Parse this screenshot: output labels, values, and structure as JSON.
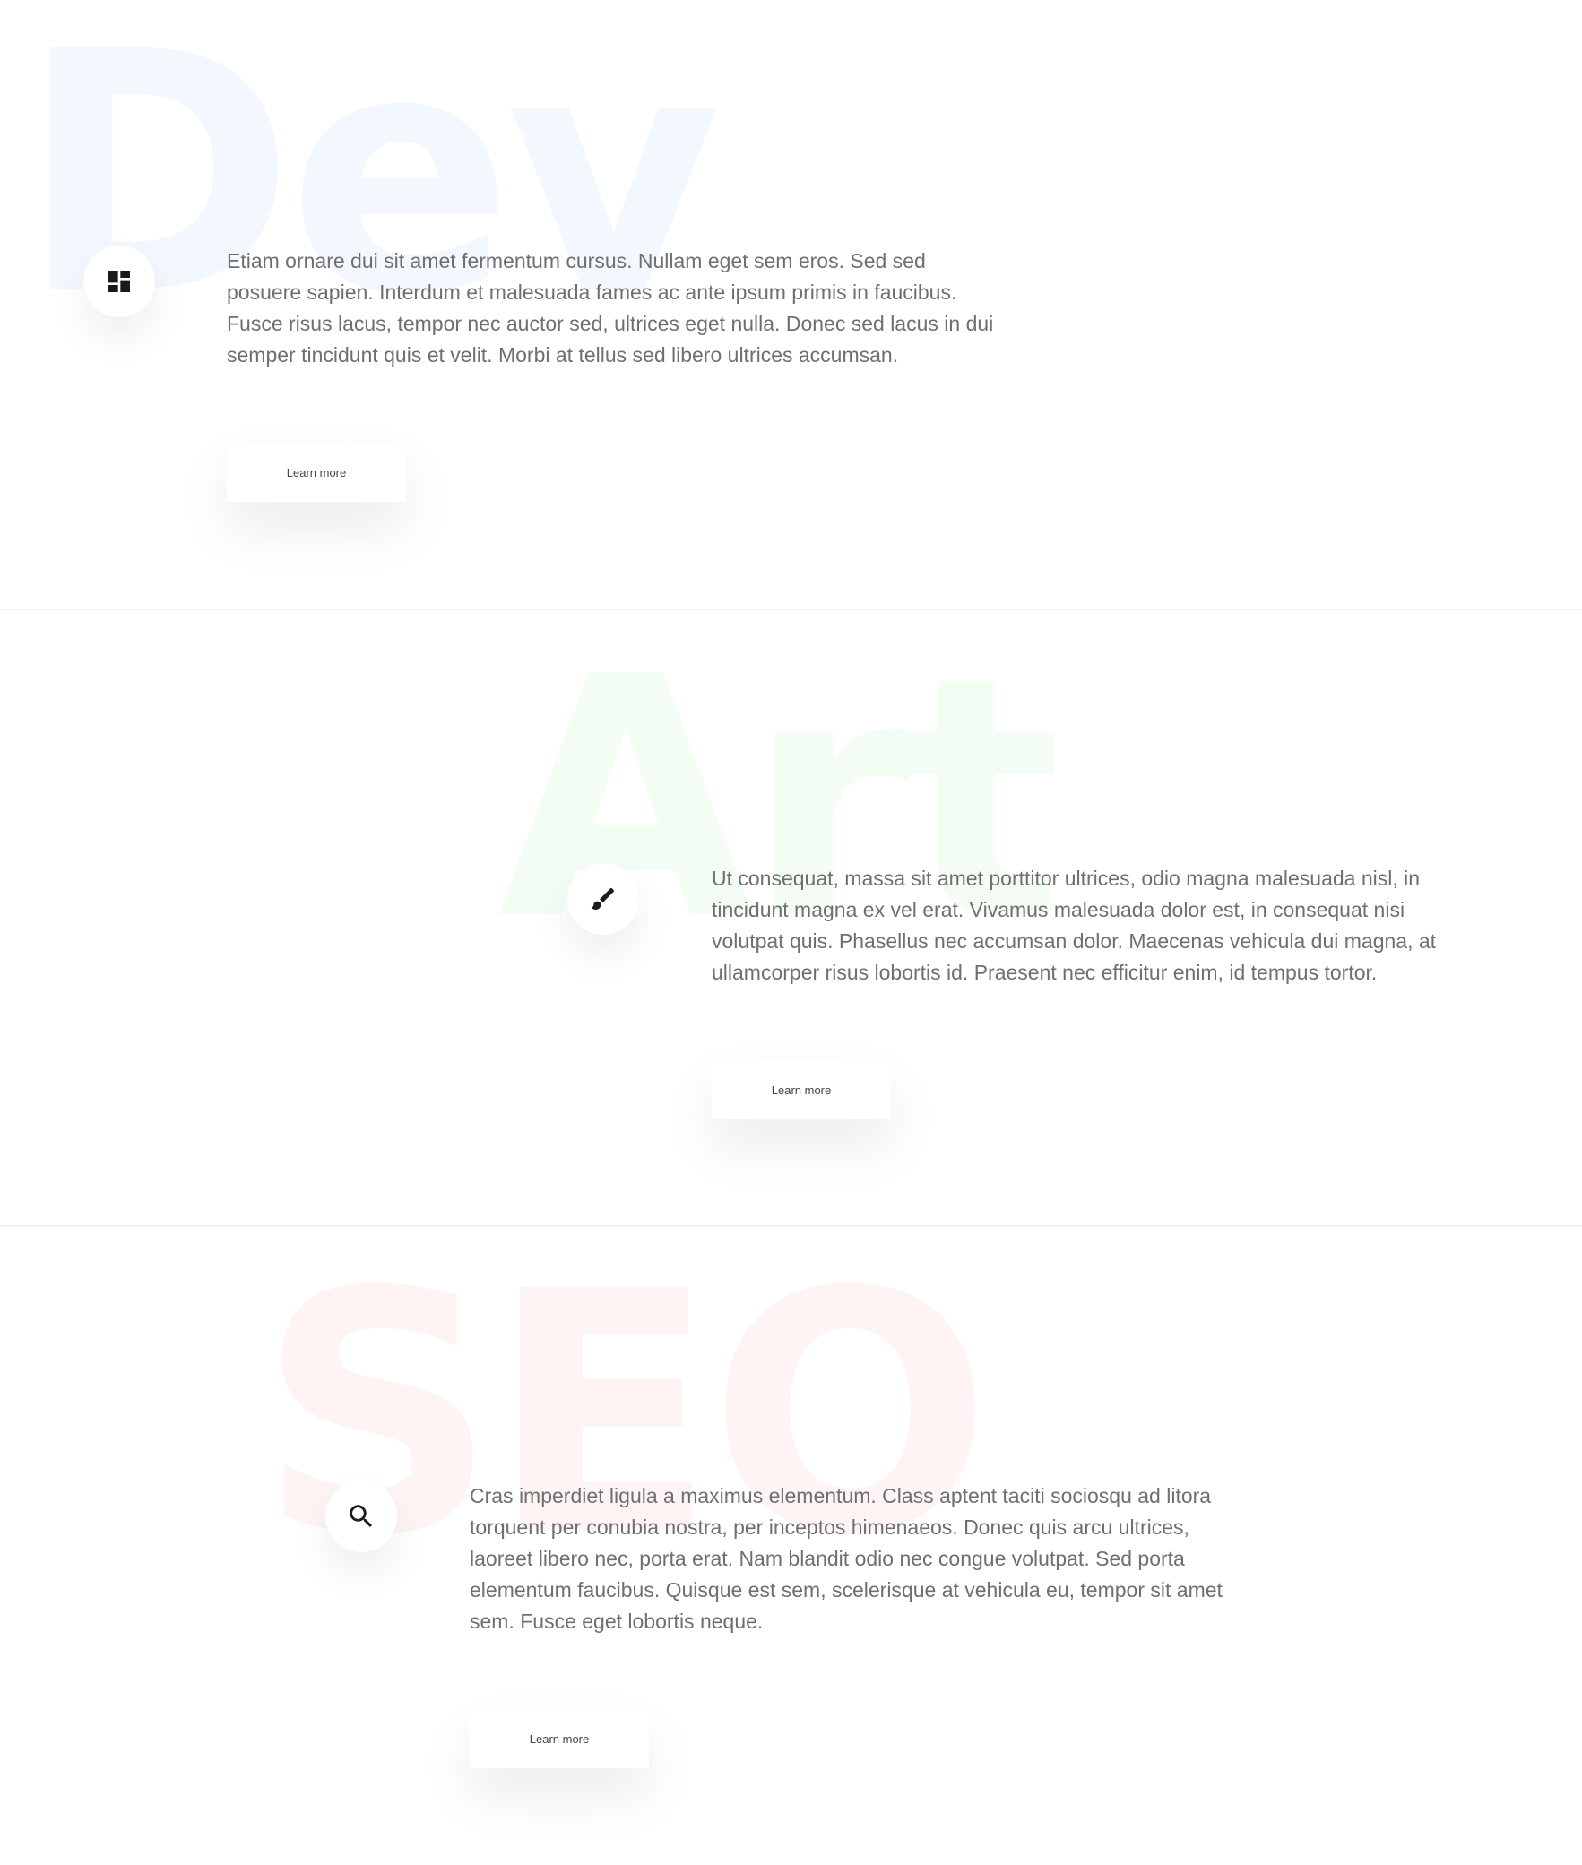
{
  "sections": [
    {
      "bg_word": "Dev",
      "bg_color": "#f3f8fe",
      "icon": "dashboard-icon",
      "text": "Etiam ornare dui sit amet fermentum cursus. Nullam eget sem eros. Sed sed posuere sapien. Interdum et malesuada fames ac ante ipsum primis in faucibus. Fusce risus lacus, tempor nec auctor sed, ultrices eget nulla. Donec sed lacus in dui semper tincidunt quis et velit. Morbi at tellus sed libero ultrices accumsan.",
      "button_label": "Learn more"
    },
    {
      "bg_word": "Art",
      "bg_color": "#f4fdf4",
      "icon": "paint-brush-icon",
      "text": "Ut consequat, massa sit amet porttitor ultrices, odio magna malesuada nisl, in tincidunt magna ex vel erat. Vivamus malesuada dolor est, in consequat nisi volutpat quis. Phasellus nec accumsan dolor. Maecenas vehicula dui magna, at ullamcorper risus lobortis id. Praesent nec efficitur enim, id tempus tortor.",
      "button_label": "Learn more"
    },
    {
      "bg_word": "SEO",
      "bg_color": "#fef4f3",
      "icon": "search-icon",
      "text": "Cras imperdiet ligula a maximus elementum. Class aptent taciti sociosqu ad litora torquent per conubia nostra, per inceptos himenaeos. Donec quis arcu ultrices, laoreet libero nec, porta erat. Nam blandit odio nec congue volutpat. Sed porta elementum faucibus. Quisque est sem, scelerisque at vehicula eu, tempor sit amet sem. Fusce eget lobortis neque.",
      "button_label": "Learn more"
    }
  ],
  "colors": {
    "icon": "#1a1a1a",
    "text": "#6f6f6f",
    "divider": "#f3f3f3"
  }
}
